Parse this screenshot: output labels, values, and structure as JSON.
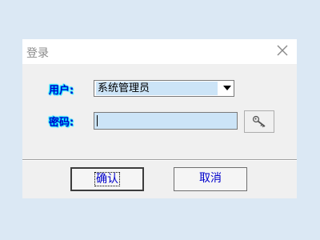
{
  "window": {
    "title": "登录"
  },
  "form": {
    "user_label": "用户:",
    "password_label": "密码:",
    "user_select": {
      "selected": "系统管理员"
    },
    "password_value": ""
  },
  "buttons": {
    "ok_label": "确认",
    "cancel_label": "取消"
  },
  "icons": {
    "close": "close-icon",
    "key": "key-icon",
    "dropdown": "chevron-down-icon"
  },
  "colors": {
    "label_text": "#0000cc",
    "label_glow": "#00e5ff",
    "field_fill": "#cce4f7",
    "button_text": "#0000cc"
  }
}
